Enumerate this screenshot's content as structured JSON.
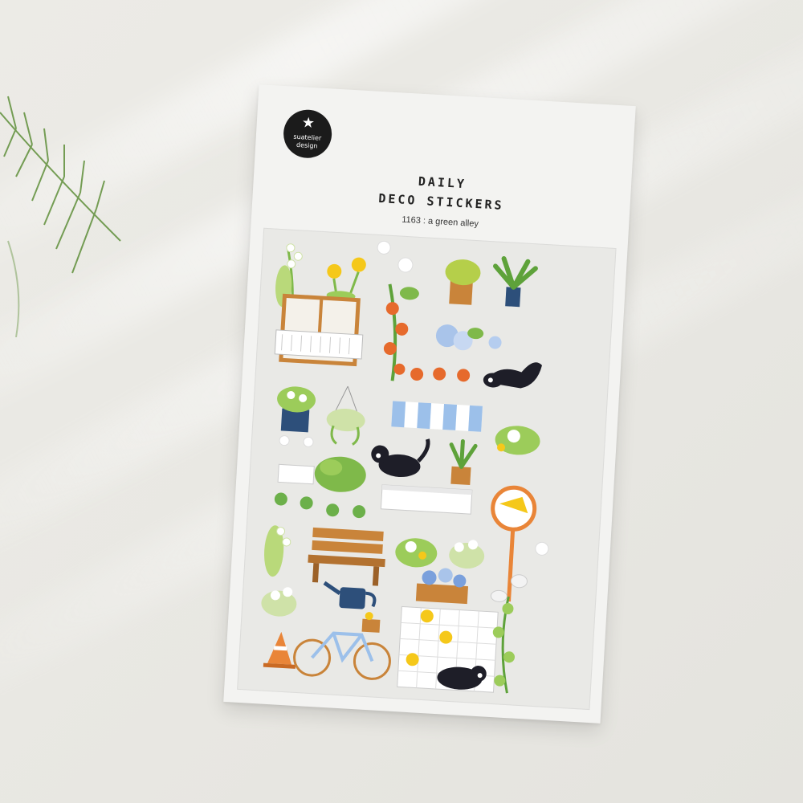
{
  "brand": {
    "logo_line1": "suatelier",
    "logo_line2": "design",
    "logo_mark": "★"
  },
  "product": {
    "title_line1": "DAILY",
    "title_line2": "DECO STICKERS",
    "subtitle": "1163 :  a green alley"
  },
  "colors": {
    "background": "#e9e8e3",
    "card": "#f3f3f1",
    "logo": "#1b1b1b",
    "leaf_green": "#8cc63f",
    "wood": "#c9843a",
    "flower_yellow": "#f5c81a",
    "cat": "#1e1e28",
    "awning_blue": "#9cc0ea"
  },
  "stickers": [
    "lily-of-the-valley-icon",
    "dandelion-icon",
    "potted-plant-icon",
    "palm-plant-icon",
    "window-balcony-icon",
    "tomato-vine-icon",
    "hydrangea-icon",
    "stretching-cat-icon",
    "potted-white-flowers-icon",
    "hanging-planter-icon",
    "striped-awning-icon",
    "walking-cat-icon",
    "clover-icon",
    "window-box-icon",
    "round-mirror-sign-icon",
    "wooden-bench-icon",
    "daisy-icon",
    "watering-can-icon",
    "flower-box-icon",
    "bicycle-icon",
    "traffic-cone-icon",
    "tiled-wall-icon",
    "sleeping-cat-icon",
    "ivy-icon"
  ]
}
